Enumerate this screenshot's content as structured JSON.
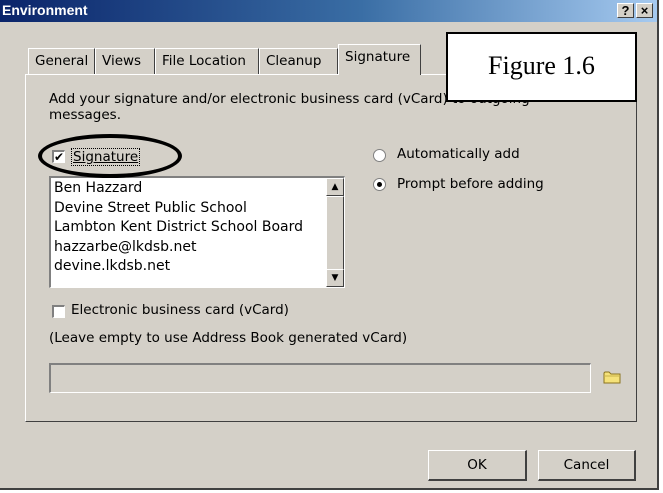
{
  "window": {
    "title": "Environment",
    "help_label": "?",
    "close_label": "×"
  },
  "tabs": [
    {
      "label": "General"
    },
    {
      "label": "Views"
    },
    {
      "label": "File Location"
    },
    {
      "label": "Cleanup"
    },
    {
      "label": "Signature",
      "active": true
    }
  ],
  "figure_label": "Figure 1.6",
  "description": "Add your signature and/or electronic business card (vCard) to outgoing messages.",
  "signature": {
    "checkbox_label": "Signature",
    "checked": true,
    "lines": [
      "Ben Hazzard",
      "Devine Street Public School",
      "Lambton Kent District School Board",
      "hazzarbe@lkdsb.net",
      "devine.lkdsb.net"
    ]
  },
  "options": {
    "auto_add": "Automatically add",
    "prompt_add": "Prompt before adding",
    "selected": "prompt_add"
  },
  "vcard": {
    "checkbox_label": "Electronic business card (vCard)",
    "checked": false,
    "hint": "(Leave empty to use Address Book generated vCard)",
    "value": ""
  },
  "buttons": {
    "ok": "OK",
    "cancel": "Cancel"
  },
  "colors": {
    "titlebar_start": "#0a246a",
    "titlebar_end": "#a6caf0",
    "face": "#d4d0c8"
  }
}
